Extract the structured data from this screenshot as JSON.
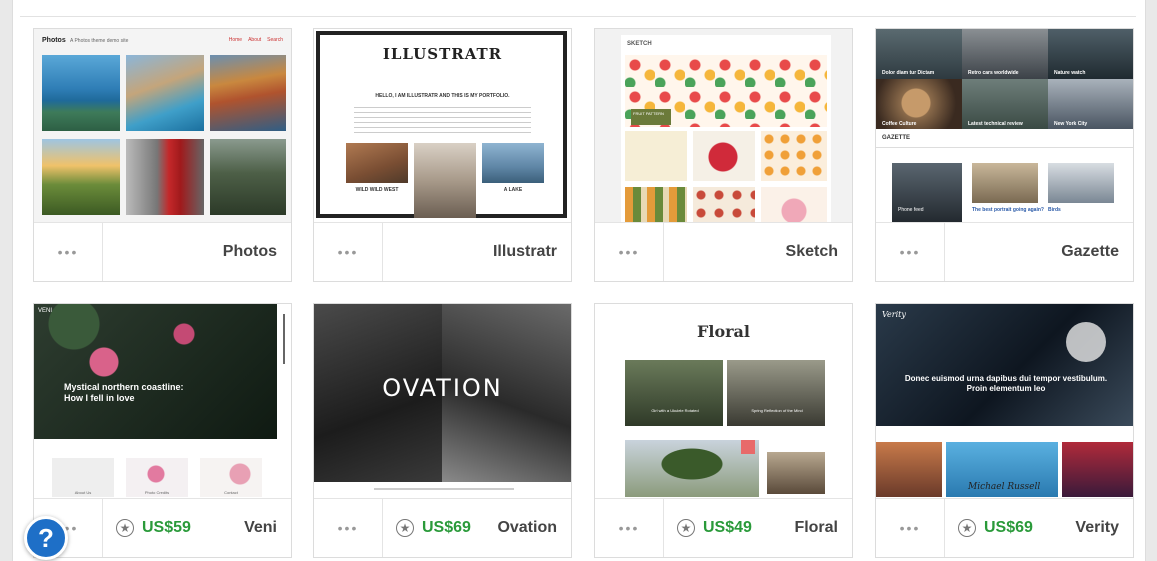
{
  "themes": [
    {
      "name": "Photos",
      "header_title": "Photos",
      "header_sub": "A Photos theme demo site",
      "nav": [
        "Home",
        "About",
        "Search"
      ]
    },
    {
      "name": "Illustratr",
      "banner": "ILLUSTRATR",
      "headline": "HELLO, I AM ILLUSTRATR AND THIS IS MY PORTFOLIO.",
      "captions": [
        "WILD WILD WEST",
        "A LAKE"
      ]
    },
    {
      "name": "Sketch",
      "banner": "SKETCH",
      "sub": "FRUIT PATTERN"
    },
    {
      "name": "Gazette",
      "banner": "GAZETTE",
      "tiles": [
        "Dolor diam tur Dictam",
        "Retro cars worldwide",
        "Nature watch",
        "Coffee Culture",
        "Latest technical review",
        "New York City"
      ],
      "items": [
        "Phone feed",
        "The best portrait going again?",
        "Birds"
      ]
    },
    {
      "name": "Veni",
      "price": "US$59",
      "banner": "VENI",
      "headline": "Mystical northern coastline: How I fell in love",
      "cards": [
        "About Us",
        "Photo Credits",
        "Contact"
      ]
    },
    {
      "name": "Ovation",
      "price": "US$69",
      "banner": "OVATION"
    },
    {
      "name": "Floral",
      "price": "US$49",
      "banner": "Floral",
      "captions": [
        "Girl with a Ukulele Rotated",
        "Spring Reflection of the Mind"
      ]
    },
    {
      "name": "Verity",
      "price": "US$69",
      "logo": "Verity",
      "headline": "Donec euismod urna dapibus dui tempor vestibulum. Proin elementum leo",
      "signature": "Michael Russell"
    }
  ],
  "ui": {
    "more_label": "•••",
    "help_label": "?",
    "star_glyph": "★"
  }
}
